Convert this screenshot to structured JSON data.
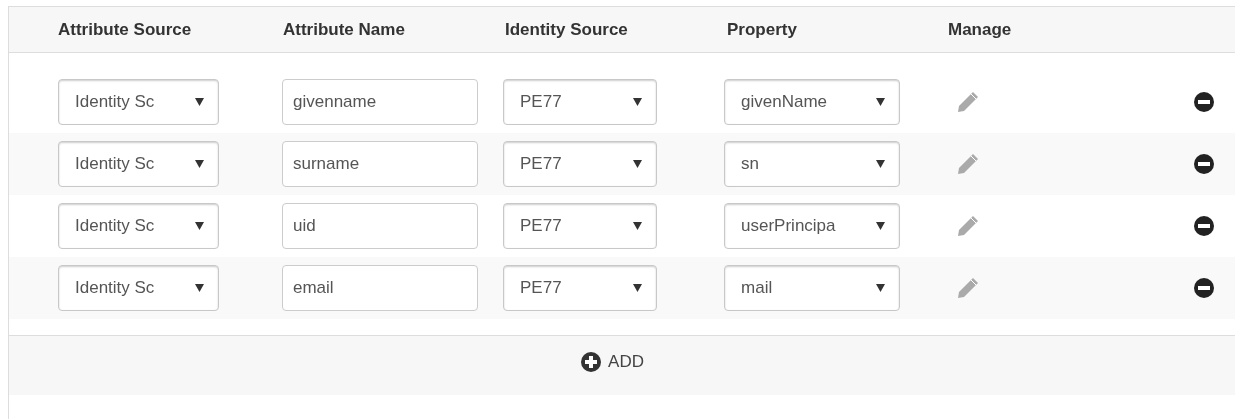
{
  "table": {
    "columns": [
      "Attribute Source",
      "Attribute Name",
      "Identity Source",
      "Property",
      "Manage"
    ],
    "rows": [
      {
        "attribute_source": "Identity Sc",
        "attribute_name": "givenname",
        "identity_source": "PE77",
        "property": "givenName"
      },
      {
        "attribute_source": "Identity Sc",
        "attribute_name": "surname",
        "identity_source": "PE77",
        "property": "sn"
      },
      {
        "attribute_source": "Identity Sc",
        "attribute_name": "uid",
        "identity_source": "PE77",
        "property": "userPrincipa"
      },
      {
        "attribute_source": "Identity Sc",
        "attribute_name": "email",
        "identity_source": "PE77",
        "property": "mail"
      }
    ]
  },
  "add_button": {
    "label": "ADD"
  }
}
